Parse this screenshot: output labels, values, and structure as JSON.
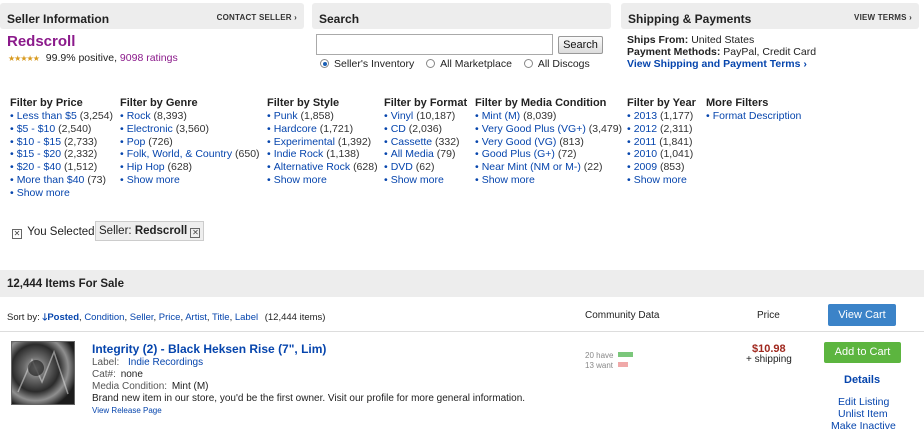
{
  "seller": {
    "section_title": "Seller Information",
    "contact_link": "CONTACT SELLER ›",
    "name": "Redscroll",
    "stars": "★★★★★",
    "positive": "99.9% positive,",
    "ratings": "9098 ratings"
  },
  "search": {
    "section_title": "Search",
    "input_value": "",
    "button_label": "Search",
    "scopes": [
      {
        "label": "Seller's Inventory",
        "selected": true
      },
      {
        "label": "All Marketplace",
        "selected": false
      },
      {
        "label": "All Discogs",
        "selected": false
      }
    ]
  },
  "shipping": {
    "section_title": "Shipping & Payments",
    "view_terms": "VIEW TERMS ›",
    "ships_from_label": "Ships From:",
    "ships_from_value": "United States",
    "payment_label": "Payment Methods:",
    "payment_value": "PayPal, Credit Card",
    "view_link": "View Shipping and Payment Terms ›"
  },
  "filters": [
    {
      "title": "Filter by Price",
      "items": [
        {
          "label": "Less than $5",
          "count": "(3,254)"
        },
        {
          "label": "$5 - $10",
          "count": "(2,540)"
        },
        {
          "label": "$10 - $15",
          "count": "(2,733)"
        },
        {
          "label": "$15 - $20",
          "count": "(2,332)"
        },
        {
          "label": "$20 - $40",
          "count": "(1,512)"
        },
        {
          "label": "More than $40",
          "count": "(73)"
        },
        {
          "label": "Show more",
          "count": ""
        }
      ]
    },
    {
      "title": "Filter by Genre",
      "items": [
        {
          "label": "Rock",
          "count": "(8,393)"
        },
        {
          "label": "Electronic",
          "count": "(3,560)"
        },
        {
          "label": "Pop",
          "count": "(726)"
        },
        {
          "label": "Folk, World, & Country",
          "count": "(650)"
        },
        {
          "label": "Hip Hop",
          "count": "(628)"
        },
        {
          "label": "Show more",
          "count": ""
        }
      ]
    },
    {
      "title": "Filter by Style",
      "items": [
        {
          "label": "Punk",
          "count": "(1,858)"
        },
        {
          "label": "Hardcore",
          "count": "(1,721)"
        },
        {
          "label": "Experimental",
          "count": "(1,392)"
        },
        {
          "label": "Indie Rock",
          "count": "(1,138)"
        },
        {
          "label": "Alternative Rock",
          "count": "(628)"
        },
        {
          "label": "Show more",
          "count": ""
        }
      ]
    },
    {
      "title": "Filter by Format",
      "items": [
        {
          "label": "Vinyl",
          "count": "(10,187)"
        },
        {
          "label": "CD",
          "count": "(2,036)"
        },
        {
          "label": "Cassette",
          "count": "(332)"
        },
        {
          "label": "All Media",
          "count": "(79)"
        },
        {
          "label": "DVD",
          "count": "(62)"
        },
        {
          "label": "Show more",
          "count": ""
        }
      ]
    },
    {
      "title": "Filter by Media Condition",
      "items": [
        {
          "label": "Mint (M)",
          "count": "(8,039)"
        },
        {
          "label": "Very Good Plus (VG+)",
          "count": "(3,479)"
        },
        {
          "label": "Very Good (VG)",
          "count": "(813)"
        },
        {
          "label": "Good Plus (G+)",
          "count": "(72)"
        },
        {
          "label": "Near Mint (NM or M-)",
          "count": "(22)"
        },
        {
          "label": "Show more",
          "count": ""
        }
      ]
    },
    {
      "title": "Filter by Year",
      "items": [
        {
          "label": "2013",
          "count": "(1,177)"
        },
        {
          "label": "2012",
          "count": "(2,311)"
        },
        {
          "label": "2011",
          "count": "(1,841)"
        },
        {
          "label": "2010",
          "count": "(1,041)"
        },
        {
          "label": "2009",
          "count": "(853)"
        },
        {
          "label": "Show more",
          "count": ""
        }
      ]
    },
    {
      "title": "More Filters",
      "items": [
        {
          "label": "Format Description",
          "count": ""
        }
      ]
    }
  ],
  "selected": {
    "label": "You Selected:",
    "chip_prefix": "Seller:",
    "chip_value": "Redscroll"
  },
  "results": {
    "count_label": "12,444 Items For Sale"
  },
  "sort": {
    "label": "Sort by:",
    "active": "Posted",
    "options": [
      "Condition",
      "Seller",
      "Price",
      "Artist",
      "Title",
      "Label"
    ],
    "count": "(12,444 items)",
    "col_community": "Community Data",
    "col_price": "Price",
    "view_cart": "View Cart"
  },
  "item": {
    "title": "Integrity (2) - Black Heksen Rise (7\", Lim)",
    "label_key": "Label:",
    "label_value": "Indie Recordings",
    "cat_key": "Cat#:",
    "cat_value": "none",
    "media_key": "Media Condition:",
    "media_value": "Mint (M)",
    "description": "Brand new item in our store, you'd be the first owner. Visit our profile for more general information.",
    "view_release": "View Release Page",
    "have": "20 have",
    "want": "13 want",
    "have_ratio": 0.6,
    "want_ratio": 0.38,
    "price": "$10.98",
    "shipping": "+ shipping",
    "add_to_cart": "Add to Cart",
    "details": "Details",
    "edit_listing": "Edit Listing",
    "unlist_item": "Unlist Item",
    "cut_off_link": "Make Inactive"
  },
  "colors": {
    "link": "#0645ad",
    "seller_name": "#8b1a8b",
    "price": "#a0281e",
    "add_to_cart": "#5cb53f",
    "view_cart": "#3b83c8",
    "have_bar": "#7bc77b",
    "want_bar": "#f0a9a9"
  }
}
